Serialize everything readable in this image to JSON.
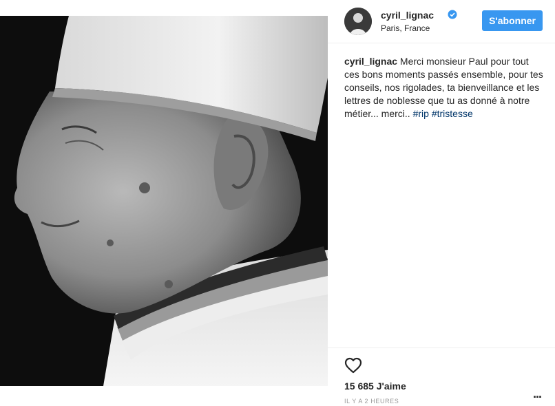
{
  "post": {
    "image_description_icon": "chef-portrait-photo",
    "header": {
      "username": "cyril_lignac",
      "location": "Paris, France",
      "follow_label": "S'abonner",
      "verified_icon": "verified-badge-icon"
    },
    "caption": {
      "username": "cyril_lignac",
      "text": " Merci monsieur Paul pour tout ces bons moments passés ensemble, pour tes conseils, nos rigolades, ta bienveillance et les lettres de noblesse que tu as donné à notre métier... merci.. ",
      "hashtags": [
        "#rip",
        "#tristesse"
      ]
    },
    "actions": {
      "like_icon": "heart-icon",
      "likes_count": "15 685",
      "likes_suffix": " J'aime",
      "timestamp": "IL Y A 2 HEURES",
      "more_label": "..."
    }
  },
  "colors": {
    "follow_button": "#3897f0",
    "hashtag": "#003569",
    "timestamp": "#999999"
  }
}
